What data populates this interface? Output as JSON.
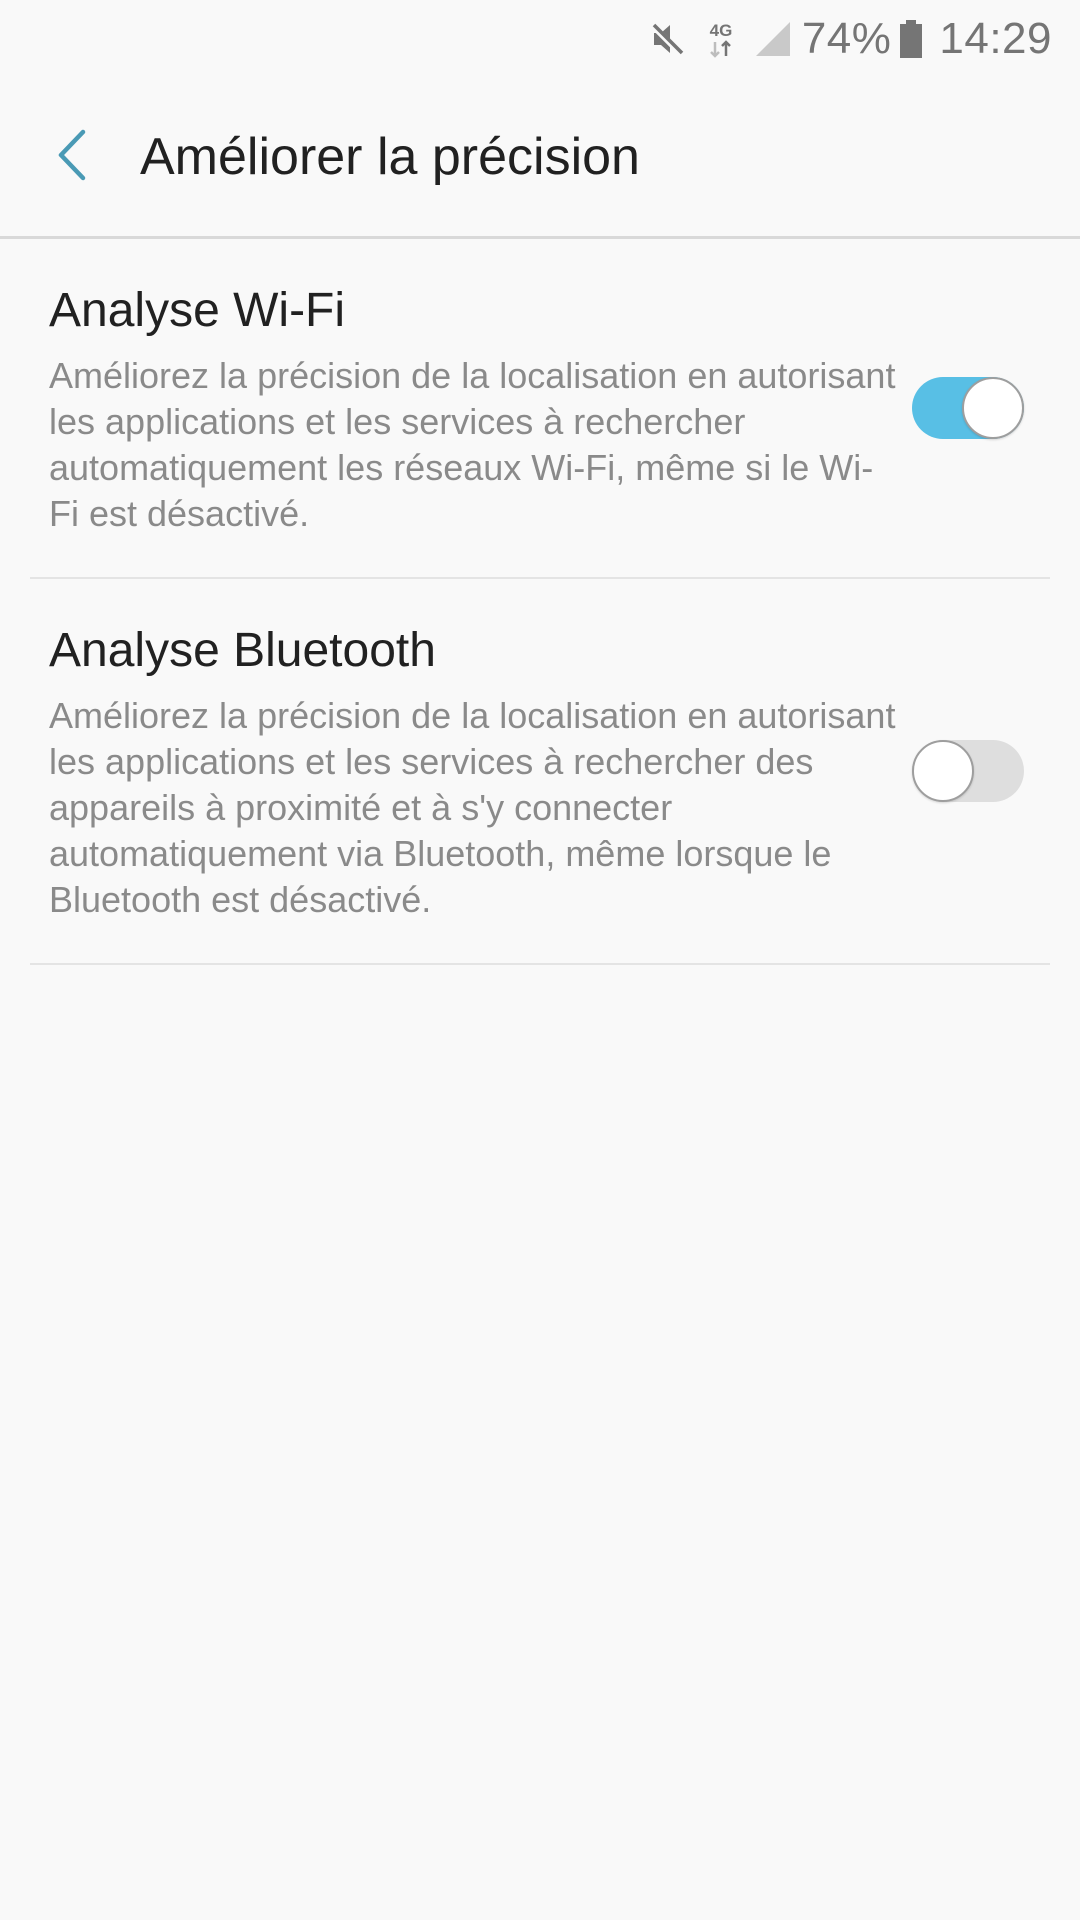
{
  "status_bar": {
    "mute_icon": "mute-icon",
    "network_label": "4G",
    "signal_icon": "signal-icon",
    "battery_percent": "74%",
    "battery_icon": "battery-icon",
    "time": "14:29"
  },
  "app_bar": {
    "back_icon": "chevron-left-icon",
    "title": "Améliorer la précision"
  },
  "settings": [
    {
      "title": "Analyse Wi-Fi",
      "description": "Améliorez la précision de la localisation en autorisant les applications et les services à rechercher automatiquement les réseaux Wi-Fi, même si le Wi-Fi est désactivé.",
      "enabled": true
    },
    {
      "title": "Analyse Bluetooth",
      "description": "Améliorez la précision de la localisation en autorisant les applications et les services à rechercher des appareils à proximité et à s'y connecter automatiquement via Bluetooth, même lorsque le Bluetooth est désactivé.",
      "enabled": false
    }
  ],
  "colors": {
    "accent": "#4a9ab5",
    "toggle_on": "#58bfe5",
    "toggle_off": "#dedede",
    "background": "#f9f9f9",
    "text_primary": "#212121",
    "text_secondary": "#8a8a8a"
  }
}
